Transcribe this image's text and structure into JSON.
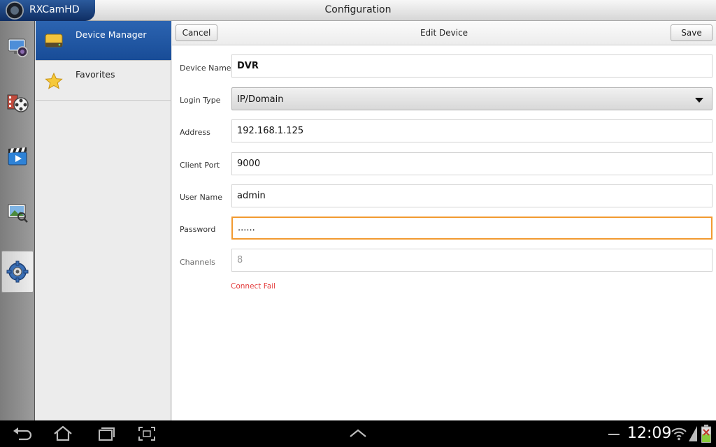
{
  "app": {
    "name": "RXCamHD",
    "title": "Configuration"
  },
  "sidebar_icons": [
    {
      "name": "live-view-icon"
    },
    {
      "name": "playback-icon"
    },
    {
      "name": "video-clip-icon"
    },
    {
      "name": "image-viewer-icon"
    },
    {
      "name": "settings-gear-icon"
    }
  ],
  "menu": {
    "items": [
      {
        "label": "Device Manager",
        "icon": "device-manager-icon",
        "selected": true
      },
      {
        "label": "Favorites",
        "icon": "star-icon",
        "selected": false
      }
    ]
  },
  "form": {
    "title": "Edit Device",
    "cancel_label": "Cancel",
    "save_label": "Save",
    "device_name": {
      "label": "Device Name",
      "value": "DVR"
    },
    "login_type": {
      "label": "Login Type",
      "value": "IP/Domain"
    },
    "address": {
      "label": "Address",
      "value": "192.168.1.125"
    },
    "client_port": {
      "label": "Client Port",
      "value": "9000"
    },
    "user_name": {
      "label": "User Name",
      "value": "admin"
    },
    "password": {
      "label": "Password",
      "value": "......"
    },
    "channels": {
      "label": "Channels",
      "value": "8"
    },
    "status": "Connect Fail"
  },
  "status_bar": {
    "time": "12:09"
  },
  "colors": {
    "accent": "#2c64b1",
    "focus": "#f29a30",
    "error": "#e33b3b"
  }
}
